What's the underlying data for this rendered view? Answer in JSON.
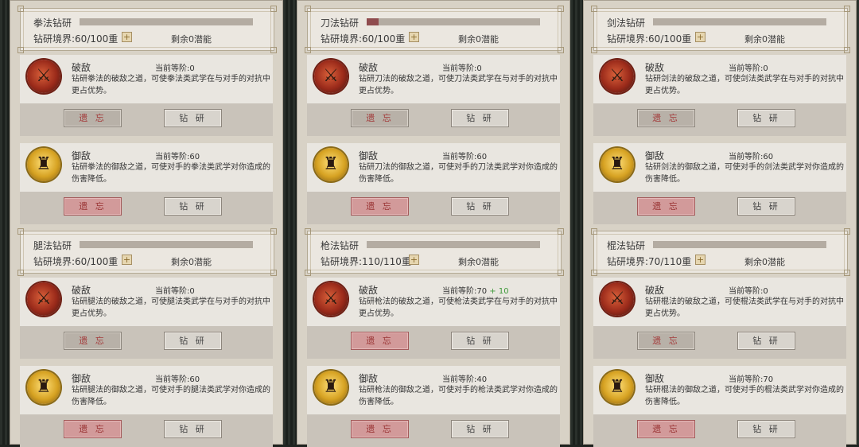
{
  "panels": [
    {
      "title": "拳法钻研",
      "progress": 0,
      "realm": "钻研境界:60/100重",
      "potential": "剩余0潜能",
      "skills": [
        {
          "name": "破敌",
          "level": "当前等阶:0",
          "bonus": "",
          "desc": "钻研拳法的破敌之道，可使拳法类武学在与对手的对抗中更占优势。",
          "forget": "遗 忘",
          "study": "钻 研",
          "forget_active": false
        },
        {
          "name": "御敌",
          "level": "当前等阶:60",
          "bonus": "",
          "desc": "钻研拳法的御敌之道，可使对手的拳法类武学对你造成的伤害降低。",
          "forget": "遗 忘",
          "study": "钻 研",
          "forget_active": true
        }
      ]
    },
    {
      "title": "刀法钻研",
      "progress": 0.07,
      "realm": "钻研境界:60/100重",
      "potential": "剩余0潜能",
      "skills": [
        {
          "name": "破敌",
          "level": "当前等阶:0",
          "bonus": "",
          "desc": "钻研刀法的破敌之道，可使刀法类武学在与对手的对抗中更占优势。",
          "forget": "遗 忘",
          "study": "钻 研",
          "forget_active": false
        },
        {
          "name": "御敌",
          "level": "当前等阶:60",
          "bonus": "",
          "desc": "钻研刀法的御敌之道，可使对手的刀法类武学对你造成的伤害降低。",
          "forget": "遗 忘",
          "study": "钻 研",
          "forget_active": true
        }
      ]
    },
    {
      "title": "剑法钻研",
      "progress": 0,
      "realm": "钻研境界:60/100重",
      "potential": "剩余0潜能",
      "skills": [
        {
          "name": "破敌",
          "level": "当前等阶:0",
          "bonus": "",
          "desc": "钻研剑法的破敌之道，可使剑法类武学在与对手的对抗中更占优势。",
          "forget": "遗 忘",
          "study": "钻 研",
          "forget_active": false
        },
        {
          "name": "御敌",
          "level": "当前等阶:60",
          "bonus": "",
          "desc": "钻研剑法的御敌之道，可使对手的剑法类武学对你造成的伤害降低。",
          "forget": "遗 忘",
          "study": "钻 研",
          "forget_active": true
        }
      ]
    },
    {
      "title": "腿法钻研",
      "progress": 0,
      "realm": "钻研境界:60/100重",
      "potential": "剩余0潜能",
      "skills": [
        {
          "name": "破敌",
          "level": "当前等阶:0",
          "bonus": "",
          "desc": "钻研腿法的破敌之道，可使腿法类武学在与对手的对抗中更占优势。",
          "forget": "遗 忘",
          "study": "钻 研",
          "forget_active": false
        },
        {
          "name": "御敌",
          "level": "当前等阶:60",
          "bonus": "",
          "desc": "钻研腿法的御敌之道，可使对手的腿法类武学对你造成的伤害降低。",
          "forget": "遗 忘",
          "study": "钻 研",
          "forget_active": true
        }
      ]
    },
    {
      "title": "枪法钻研",
      "progress": 0,
      "realm": "钻研境界:110/110重",
      "potential": "剩余0潜能",
      "skills": [
        {
          "name": "破敌",
          "level": "当前等阶:70",
          "bonus": " + 10",
          "desc": "钻研枪法的破敌之道，可使枪法类武学在与对手的对抗中更占优势。",
          "forget": "遗 忘",
          "study": "钻 研",
          "forget_active": true
        },
        {
          "name": "御敌",
          "level": "当前等阶:40",
          "bonus": "",
          "desc": "钻研枪法的御敌之道，可使对手的枪法类武学对你造成的伤害降低。",
          "forget": "遗 忘",
          "study": "钻 研",
          "forget_active": true
        }
      ]
    },
    {
      "title": "棍法钻研",
      "progress": 0,
      "realm": "钻研境界:70/110重",
      "potential": "剩余0潜能",
      "skills": [
        {
          "name": "破敌",
          "level": "当前等阶:0",
          "bonus": "",
          "desc": "钻研棍法的破敌之道，可使棍法类武学在与对手的对抗中更占优势。",
          "forget": "遗 忘",
          "study": "钻 研",
          "forget_active": false
        },
        {
          "name": "御敌",
          "level": "当前等阶:70",
          "bonus": "",
          "desc": "钻研棍法的御敌之道，可使对手的棍法类武学对你造成的伤害降低。",
          "forget": "遗 忘",
          "study": "钻 研",
          "forget_active": true
        }
      ]
    }
  ],
  "icons": {
    "po": "broken-sword-icon",
    "yu": "armored-guard-icon"
  },
  "colors": {
    "bar_fill": "#8f4c4e",
    "bonus_green": "#3f9a3a",
    "forget_active": "#d29a9a"
  }
}
